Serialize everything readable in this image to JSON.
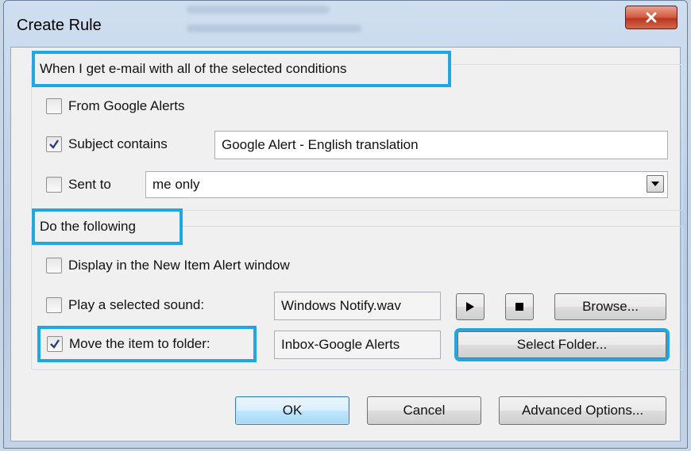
{
  "window": {
    "title": "Create Rule"
  },
  "conditions": {
    "legend": "When I get e-mail with all of the selected conditions",
    "from": {
      "label": "From Google Alerts",
      "checked": false
    },
    "subject": {
      "label": "Subject contains",
      "checked": true,
      "value": "Google Alert - English translation"
    },
    "sent_to": {
      "label": "Sent to",
      "checked": false,
      "selected": "me only"
    }
  },
  "actions": {
    "legend": "Do the following",
    "display": {
      "label": "Display in the New Item Alert window",
      "checked": false
    },
    "sound": {
      "label": "Play a selected sound:",
      "checked": false,
      "value": "Windows Notify.wav",
      "browse_label": "Browse..."
    },
    "move": {
      "label": "Move the item to folder:",
      "checked": true,
      "value": "Inbox-Google Alerts",
      "select_label": "Select Folder..."
    }
  },
  "footer": {
    "ok_label": "OK",
    "cancel_label": "Cancel",
    "advanced_label": "Advanced Options..."
  },
  "colors": {
    "highlight": "#1ea7e1",
    "close_button": "#cf5a3e"
  },
  "icons": [
    "close-icon",
    "checkmark-icon",
    "dropdown-arrow-icon",
    "play-icon",
    "stop-icon"
  ]
}
